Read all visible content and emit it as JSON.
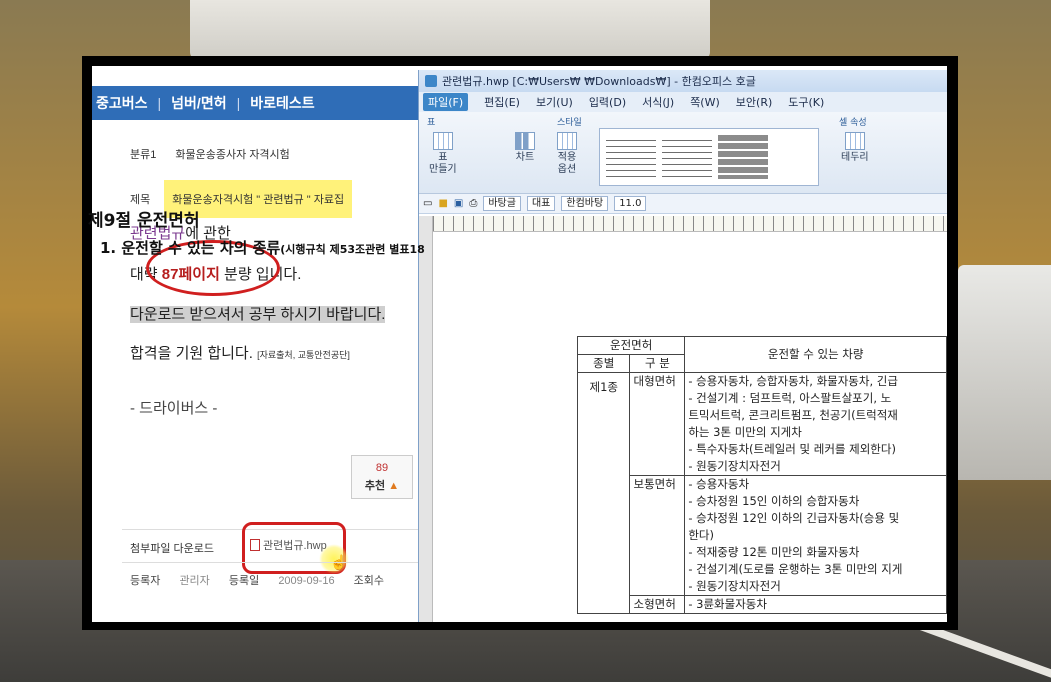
{
  "web": {
    "nav": [
      "중고버스",
      "넘버/면허",
      "바로테스트"
    ],
    "category_label": "분류1",
    "category_value": "화물운송종사자 자격시험",
    "subject_label": "제목",
    "subject_value": "화물운송자격시험 \" 관련법규 \" 자료집",
    "line1_a": "관련법규",
    "line1_b": "에 관한",
    "line2_a": "대략 ",
    "line2_b": "87페이지",
    "line2_c": " 분량 입니다.",
    "line3": "다운로드 받으셔서 공부 하시기 바랍니다.",
    "line4": "합격을 기원 합니다.",
    "line4_source": "[자료출처, 교통안전공단]",
    "signature": "- 드라이버스 -",
    "vote_count": "89",
    "vote_label": "추천",
    "attach_label": "첨부파일 다운로드",
    "attach_file": "관련법규.hwp",
    "meta_author_label": "등록자",
    "meta_author": "관리자",
    "meta_date_label": "등록일",
    "meta_date": "2009-09-16",
    "meta_views_label": "조회수"
  },
  "hwp": {
    "title": "관련법규.hwp [C:₩Users₩        ₩Downloads₩] - 한컴오피스 호글",
    "menus": [
      "파일(F)",
      "편집(E)",
      "보기(U)",
      "입력(D)",
      "서식(J)",
      "쪽(W)",
      "보안(R)",
      "도구(K)"
    ],
    "group_table": "표",
    "group_style": "스타일",
    "group_cell": "셀 속성",
    "btn_table": "표",
    "btn_table2": "만들기",
    "btn_chart": "차트",
    "btn_apply": "적용",
    "btn_apply2": "옵션",
    "btn_border": "테두리",
    "font_style": "바탕글",
    "para_style": "대표",
    "font_name": "한컴바탕",
    "font_size": "11.0",
    "heading1": "제9절 운전면허",
    "heading2": "1. 운전할 수 있는 차의 종류",
    "heading2_small": "(시행규칙 제53조관련 별표18",
    "table": {
      "head_top": "운전면허",
      "head_col1": "종별",
      "head_col2": "구 분",
      "head_col3": "운전할 수 있는 차량",
      "class1": "제1종",
      "row1_type": "대형면허",
      "row1_lines": [
        "- 승용자동차, 승합자동차, 화물자동차, 긴급",
        "- 건설기계 : 덤프트럭, 아스팔트살포기, 노",
        "  트믹서트럭, 콘크리트펌프, 천공기(트럭적재",
        "  하는 3톤 미만의 지게차",
        "- 특수자동차(트레일러 및 레커를 제외한다)",
        "- 원동기장치자전거"
      ],
      "row2_type": "보통면허",
      "row2_lines": [
        "- 승용자동차",
        "- 승차정원 15인 이하의 승합자동차",
        "- 승차정원 12인 이하의 긴급자동차(승용 및",
        "  한다)",
        "- 적재중량 12톤 미만의 화물자동차",
        "- 건설기계(도로를 운행하는 3톤 미만의 지게",
        "- 원동기장치자전거"
      ],
      "row3_type": "소형면허",
      "row3_lines": [
        "- 3륜화물자동차"
      ]
    }
  }
}
